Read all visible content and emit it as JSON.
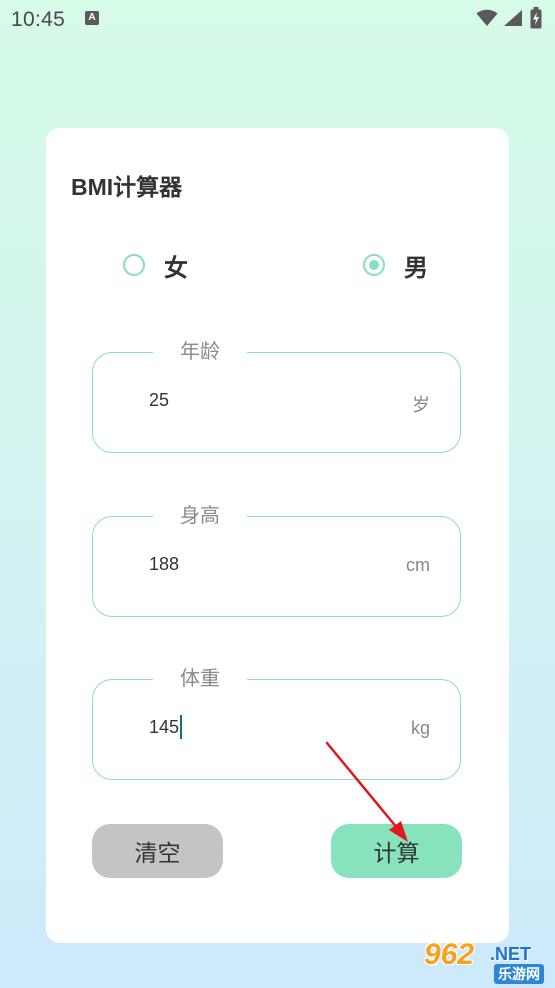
{
  "status_bar": {
    "time": "10:45",
    "notification_icon_letter": "A"
  },
  "card": {
    "title": "BMI计算器"
  },
  "gender": {
    "options": [
      {
        "label": "女",
        "checked": false
      },
      {
        "label": "男",
        "checked": true
      }
    ]
  },
  "fields": {
    "age": {
      "legend": "年龄",
      "value": "25",
      "unit": "岁"
    },
    "height": {
      "legend": "身高",
      "value": "188",
      "unit": "cm"
    },
    "weight": {
      "legend": "体重",
      "value": "145",
      "unit": "kg"
    }
  },
  "buttons": {
    "clear_label": "清空",
    "calculate_label": "计算"
  },
  "colors": {
    "accent": "#86dfc0",
    "calculate_button": "#86e3bb",
    "clear_button": "#c4c4c4",
    "annotation_arrow": "#e0191f"
  },
  "watermark": {
    "number": "962",
    "suffix": ".NET",
    "cn_text": "乐游网"
  }
}
